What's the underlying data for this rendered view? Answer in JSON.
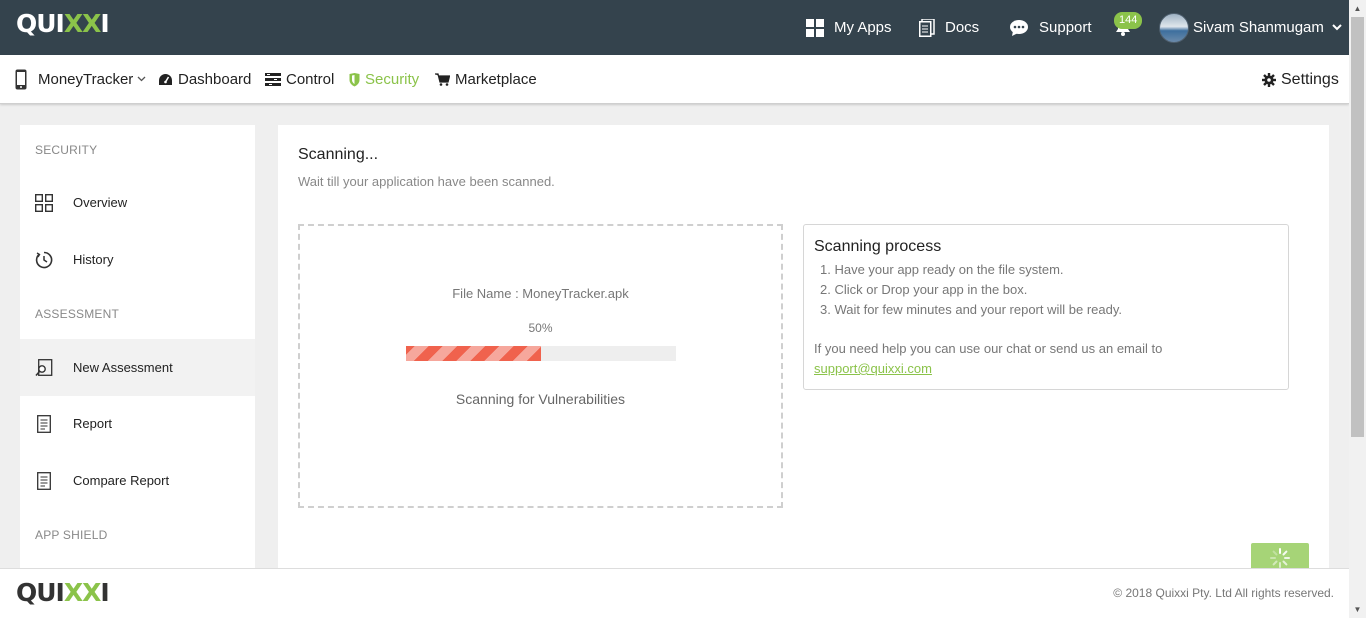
{
  "brand": {
    "logo_prefix": "QUI",
    "logo_highlight": "XX",
    "logo_suffix": "I",
    "accent_color": "#8bc34a",
    "topbar_color": "#34434d"
  },
  "topnav": {
    "myapps_label": "My Apps",
    "docs_label": "Docs",
    "support_label": "Support",
    "notification_count": "144",
    "user_name": "Sivam Shanmugam"
  },
  "subnav": {
    "app_name": "MoneyTracker",
    "dashboard_label": "Dashboard",
    "control_label": "Control",
    "security_label": "Security",
    "marketplace_label": "Marketplace",
    "settings_label": "Settings"
  },
  "sidebar": {
    "security_section": "SECURITY",
    "overview_label": "Overview",
    "history_label": "History",
    "assessment_section": "ASSESSMENT",
    "new_assessment_label": "New Assessment",
    "report_label": "Report",
    "compare_report_label": "Compare Report",
    "appshield_section": "APP SHIELD"
  },
  "main": {
    "title": "Scanning...",
    "subtitle": "Wait till your application have been scanned.",
    "file_name": "File Name : MoneyTracker.apk",
    "progress_text": "50%",
    "progress_value": 50,
    "status_text": "Scanning for Vulnerabilities"
  },
  "process": {
    "title": "Scanning process",
    "steps": [
      "1. Have your app ready on the file system.",
      "2. Click or Drop your app in the box.",
      "3. Wait for few minutes and your report will be ready."
    ],
    "help_text": "If you need help you can use our chat or send us an email to",
    "support_email": "support@quixxi.com"
  },
  "footer": {
    "copyright": "© 2018 Quixxi Pty. Ltd All rights reserved."
  }
}
